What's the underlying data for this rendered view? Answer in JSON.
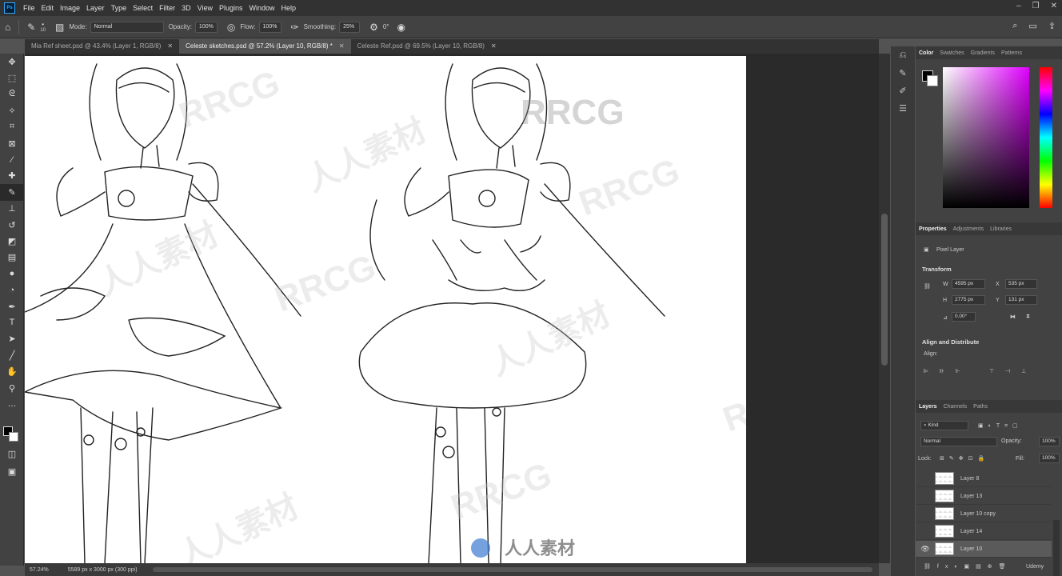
{
  "app": {
    "logo": "Ps"
  },
  "menu": [
    "File",
    "Edit",
    "Image",
    "Layer",
    "Type",
    "Select",
    "Filter",
    "3D",
    "View",
    "Plugins",
    "Window",
    "Help"
  ],
  "options": {
    "brush_size": "10",
    "mode_label": "Mode:",
    "mode_value": "Normal",
    "opacity_label": "Opacity:",
    "opacity_value": "100%",
    "flow_label": "Flow:",
    "flow_value": "100%",
    "smoothing_label": "Smoothing:",
    "smoothing_value": "25%",
    "angle_value": "0°"
  },
  "tabs": [
    {
      "label": "Mia Ref sheet.psd @ 43.4% (Layer 1, RGB/8)",
      "active": false
    },
    {
      "label": "Celeste sketches.psd @ 57.2% (Layer 10, RGB/8) *",
      "active": true
    },
    {
      "label": "Celeste Ref.psd @ 69.5% (Layer 10, RGB/8)",
      "active": false
    }
  ],
  "status": {
    "zoom": "57.24%",
    "doc_size": "5589 px x 3000 px (300 ppi)"
  },
  "color_panel": {
    "tabs": [
      "Color",
      "Swatches",
      "Gradients",
      "Patterns"
    ]
  },
  "properties_panel": {
    "tabs": [
      "Properties",
      "Adjustments",
      "Libraries"
    ],
    "layer_type": "Pixel Layer",
    "transform_title": "Transform",
    "w_label": "W",
    "w_value": "4595 px",
    "x_label": "X",
    "x_value": "535 px",
    "h_label": "H",
    "h_value": "2775 px",
    "y_label": "Y",
    "y_value": "131 px",
    "angle_value": "0.00°",
    "align_title": "Align and Distribute",
    "align_label": "Align:"
  },
  "layers_panel": {
    "tabs": [
      "Layers",
      "Channels",
      "Paths"
    ],
    "kind_label": "Kind",
    "blend_mode": "Normal",
    "opacity_label": "Opacity:",
    "opacity_value": "100%",
    "lock_label": "Lock:",
    "fill_label": "Fill:",
    "fill_value": "100%",
    "layers": [
      {
        "name": "Layer 8",
        "visible": false,
        "selected": false
      },
      {
        "name": "Layer 13",
        "visible": false,
        "selected": false
      },
      {
        "name": "Layer 10 copy",
        "visible": false,
        "selected": false
      },
      {
        "name": "Layer 14",
        "visible": false,
        "selected": false
      },
      {
        "name": "Layer 10",
        "visible": true,
        "selected": true
      }
    ]
  },
  "watermark": {
    "text": "RRCG",
    "cn_text": "人人素材",
    "udemy": "Udemy"
  }
}
